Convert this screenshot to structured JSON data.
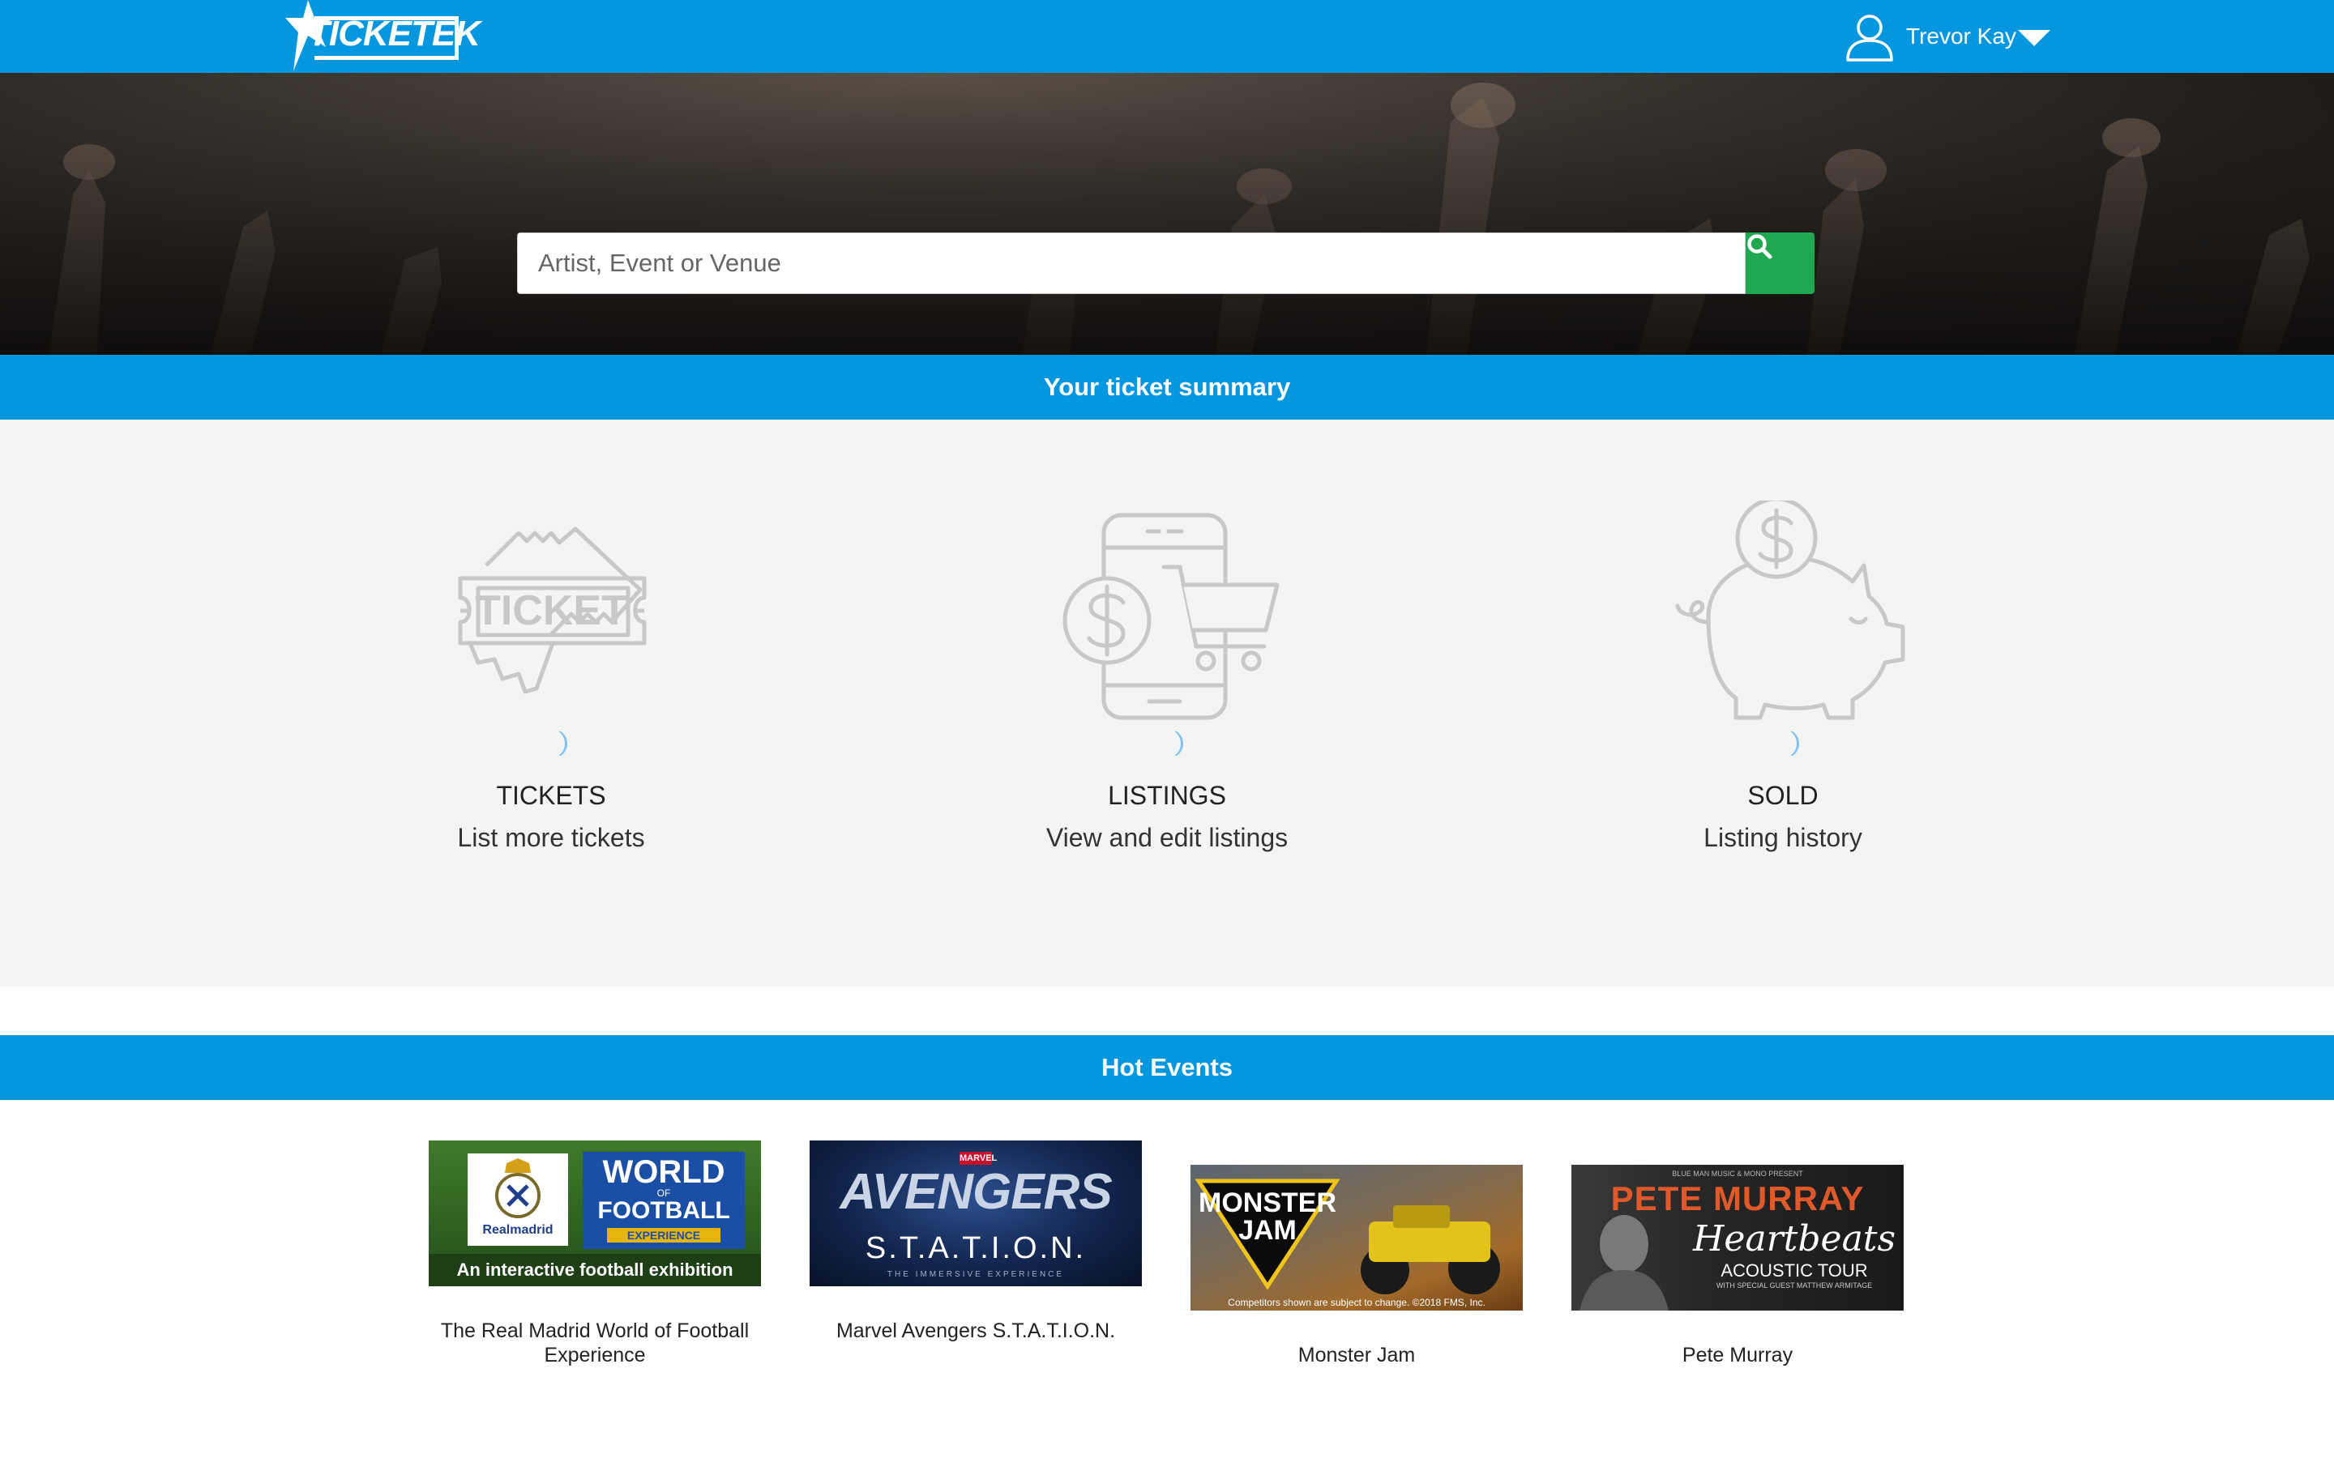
{
  "header": {
    "logo_text": "TICKETEK",
    "user_name": "Trevor Kay",
    "user_icon": "user-icon",
    "dropdown_icon": "caret-down-icon"
  },
  "search": {
    "placeholder": "Artist, Event or Venue",
    "button_icon": "search-icon"
  },
  "summary": {
    "heading": "Your ticket summary",
    "items": [
      {
        "icon": "ticket-icon",
        "title": "TICKETS",
        "subtitle": "List more tickets"
      },
      {
        "icon": "phone-cart-icon",
        "title": "LISTINGS",
        "subtitle": "View and edit listings"
      },
      {
        "icon": "piggy-bank-icon",
        "title": "SOLD",
        "subtitle": "Listing history"
      }
    ]
  },
  "hot_events": {
    "heading": "Hot Events",
    "events": [
      {
        "name": "The Real Madrid World of Football Experience",
        "image": {
          "club": "Realmadrid",
          "title_1": "WORLD",
          "title_2": "OF",
          "title_3": "FOOTBALL",
          "badge": "EXPERIENCE",
          "tagline": "An interactive football exhibition"
        }
      },
      {
        "name": "Marvel Avengers S.T.A.T.I.O.N.",
        "image": {
          "brand": "MARVEL",
          "title": "AVENGERS",
          "subtitle": "S.T.A.T.I.O.N.",
          "tagline": "THE IMMERSIVE EXPERIENCE"
        }
      },
      {
        "name": "Monster Jam",
        "image": {
          "title_1": "MONSTER",
          "title_2": "JAM",
          "disclaimer": "Competitors shown are subject to change. ©2018 FMS, Inc."
        }
      },
      {
        "name": "Pete Murray",
        "image": {
          "presenter": "BLUE MAN MUSIC & MONO PRESENT",
          "title": "PETE MURRAY",
          "script": "Heartbeats",
          "tour": "ACOUSTIC TOUR",
          "guest": "WITH SPECIAL GUEST MATTHEW ARMITAGE"
        }
      }
    ]
  },
  "colors": {
    "brand_blue": "#0497e0",
    "search_green": "#1fa84f",
    "summary_bg": "#f4f4f4",
    "icon_gray": "#c8c8c8"
  }
}
